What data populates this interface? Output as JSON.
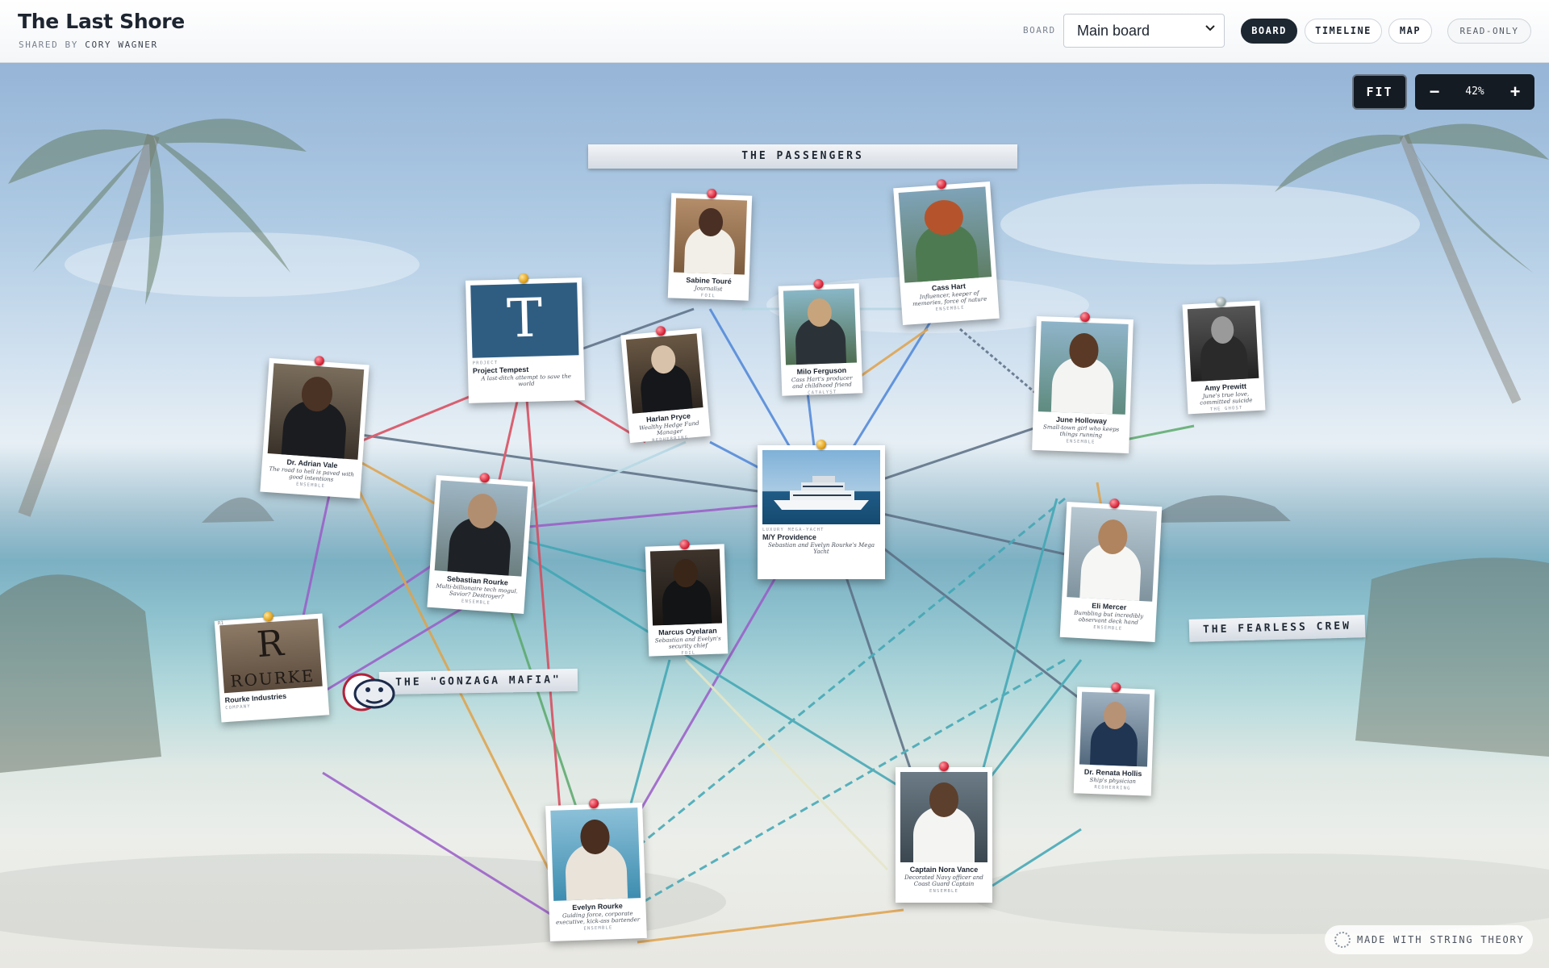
{
  "header": {
    "title": "The Last Shore",
    "shared_prefix": "SHARED BY",
    "shared_by": "CORY WAGNER",
    "board_label": "BOARD",
    "board_selected": "Main board",
    "views": [
      "BOARD",
      "TIMELINE",
      "MAP"
    ],
    "active_view": "BOARD",
    "mode_badge": "READ-ONLY"
  },
  "zoom": {
    "fit_label": "FIT",
    "minus": "−",
    "plus": "+",
    "level": "42%"
  },
  "sections": {
    "passengers": "THE PASSENGERS",
    "crew": "THE FEARLESS CREW",
    "mafia": "THE \"GONZAGA MAFIA\""
  },
  "cards": {
    "sabine": {
      "name": "Sabine Touré",
      "desc": "Journalist",
      "tag": "FOIL"
    },
    "cass": {
      "name": "Cass Hart",
      "desc": "Influencer, keeper of memories, force of nature",
      "tag": "ENSEMBLE"
    },
    "project": {
      "kind": "PROJECT",
      "name": "Project Tempest",
      "desc": "A last-ditch attempt to save the world",
      "logo": "T"
    },
    "milo": {
      "name": "Milo Ferguson",
      "desc": "Cass Hart's producer and childhood friend",
      "tag": "CATALYST"
    },
    "harlan": {
      "name": "Harlan Pryce",
      "desc": "Wealthy Hedge Fund Manager",
      "tag": "REDHERRING"
    },
    "june": {
      "name": "June Holloway",
      "desc": "Small-town girl who keeps things running",
      "tag": "ENSEMBLE"
    },
    "amy": {
      "name": "Amy Prewitt",
      "desc": "June's true love, committed suicide",
      "tag": "THE GHOST"
    },
    "adrian": {
      "name": "Dr. Adrian Vale",
      "desc": "The road to hell is paved with good intentions",
      "tag": "ENSEMBLE"
    },
    "sebastian": {
      "name": "Sebastian Rourke",
      "desc": "Multi-billionaire tech mogul. Savior? Destroyer?",
      "tag": "ENSEMBLE"
    },
    "yacht": {
      "kind": "LUXURY MEGA-YACHT",
      "name": "M/Y Providence",
      "desc": "Sebastian and Evelyn Rourke's Mega Yacht"
    },
    "eli": {
      "name": "Eli Mercer",
      "desc": "Bumbling but incredibly observant deck hand",
      "tag": "ENSEMBLE"
    },
    "marcus": {
      "name": "Marcus Oyelaran",
      "desc": "Sebastian and Evelyn's security chief",
      "tag": "FOIL"
    },
    "rourke_ind": {
      "corner": "R1",
      "name": "Rourke Industries",
      "desc": "COMPANY",
      "logo_letter": "R",
      "logo_word": "ROURKE"
    },
    "renata": {
      "name": "Dr. Renata Hollis",
      "desc": "Ship's physician",
      "tag": "REDHERRING"
    },
    "nora": {
      "name": "Captain Nora Vance",
      "desc": "Decorated Navy officer and Coast Guard Captain",
      "tag": "ENSEMBLE"
    },
    "evelyn": {
      "name": "Evelyn Rourke",
      "desc": "Guiding force, corporate executive, kick-ass bartender",
      "tag": "ENSEMBLE"
    }
  },
  "footer": {
    "badge": "MADE WITH STRING THEORY"
  },
  "colors": {
    "red_string": "#d9485a",
    "blue_string": "#4e86d8",
    "teal_string": "#3fa6b4",
    "purple_string": "#9a5cc8",
    "orange_string": "#e0a24a",
    "green_string": "#5aa86a",
    "grey_string": "#5b6e84"
  },
  "icons": {
    "dropdown": "chevron-down-icon",
    "footer_logo": "string-theory-logo-icon",
    "mafia_logo": "bulldog-logo-icon"
  }
}
